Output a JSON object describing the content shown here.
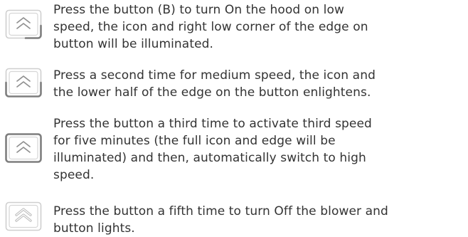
{
  "steps": [
    {
      "icon": "chevron-up-icon",
      "lines": [
        "Press the button (B) to turn On the hood on low",
        "speed, the icon and right low corner of the edge on",
        "button will be illuminated."
      ]
    },
    {
      "icon": "chevron-up-icon",
      "lines": [
        "Press a second time for medium speed, the icon and",
        "the lower half of the edge on the button enlightens."
      ]
    },
    {
      "icon": "chevron-up-icon",
      "lines": [
        "Press the button a third time to activate third speed",
        "for five minutes (the full icon and edge will be",
        "illuminated) and then, automatically switch to high",
        "speed."
      ]
    },
    {
      "icon": "chevron-up-outline-icon",
      "lines": [
        "Press the button a fifth time to turn Off the blower and",
        "button lights."
      ]
    }
  ],
  "colors": {
    "text": "#333333",
    "button_outline": "#c9c9c9",
    "button_lit": "#8a8a8a",
    "chevron": "#8f8f8f"
  }
}
